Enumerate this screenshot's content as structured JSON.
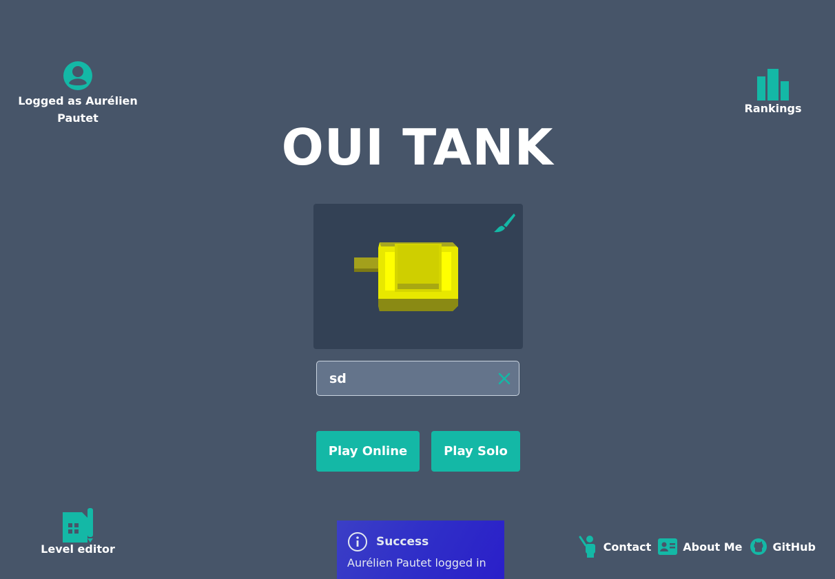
{
  "user": {
    "label": "Logged as Aurélien Pautet",
    "icon": "user-circle-icon"
  },
  "rankings": {
    "label": "Rankings",
    "icon": "bar-chart-icon"
  },
  "editor": {
    "label": "Level editor",
    "icon": "level-editor-icon"
  },
  "title": "OUI TANK",
  "preview": {
    "customize_icon": "paintbrush-icon",
    "tank_color": "#e8e800"
  },
  "name_input": {
    "value": "sd",
    "clear_icon": "close-icon"
  },
  "buttons": {
    "play_online": "Play Online",
    "play_solo": "Play Solo"
  },
  "toast": {
    "title": "Success",
    "message": "Aurélien Pautet logged in",
    "icon": "info-icon"
  },
  "footer": {
    "contact": "Contact",
    "about": "About Me",
    "github": "GitHub"
  },
  "colors": {
    "background": "#475569",
    "accent": "#14b8a6",
    "panel": "#334155",
    "toast": "#2f2ec8"
  }
}
